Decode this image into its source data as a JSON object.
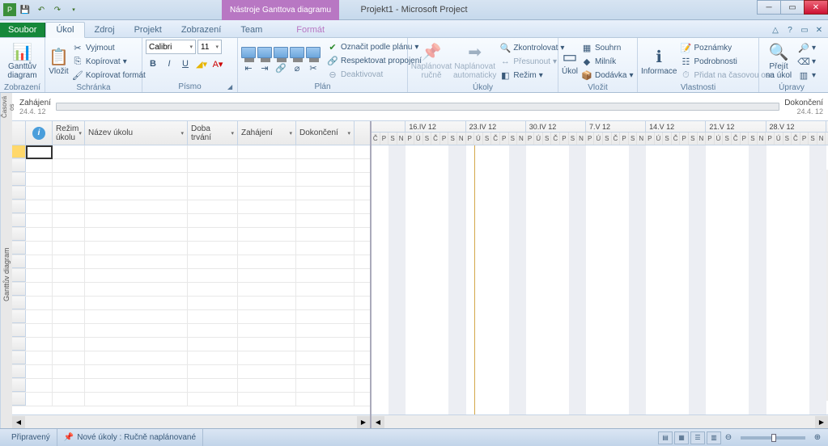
{
  "title": "Projekt1 - Microsoft Project",
  "contextual_tab_title": "Nástroje Ganttova diagramu",
  "tabs": {
    "file": "Soubor",
    "items": [
      "Úkol",
      "Zdroj",
      "Projekt",
      "Zobrazení",
      "Team"
    ],
    "format": "Formát",
    "active_index": 0
  },
  "ribbon": {
    "zobrazeni": {
      "label": "Zobrazení",
      "btn": "Ganttův\ndiagram"
    },
    "schranka": {
      "label": "Schránka",
      "paste": "Vložit",
      "cut": "Vyjmout",
      "copy": "Kopírovat",
      "format_painter": "Kopírovat formát"
    },
    "pismo": {
      "label": "Písmo",
      "font": "Calibri",
      "size": "11"
    },
    "plan": {
      "label": "Plán",
      "mark_on_track": "Označit podle plánu",
      "respect_links": "Respektovat propojení",
      "deactivate": "Deaktivovat"
    },
    "ukoly": {
      "label": "Úkoly",
      "manual": "Naplánovat\nručně",
      "auto": "Naplánovat\nautomaticky",
      "inspect": "Zkontrolovat",
      "move": "Přesunout",
      "mode": "Režim"
    },
    "vlozit": {
      "label": "Vložit",
      "task": "Úkol",
      "summary": "Souhrn",
      "milestone": "Milník",
      "deliverable": "Dodávka"
    },
    "vlastnosti": {
      "label": "Vlastnosti",
      "info": "Informace",
      "notes": "Poznámky",
      "details": "Podrobnosti",
      "add_timeline": "Přidat na časovou osu"
    },
    "upravy": {
      "label": "Úpravy",
      "scroll": "Přejít\nna úkol"
    }
  },
  "timeline": {
    "start_label": "Zahájení",
    "end_label": "Dokončení",
    "start_date": "24.4. 12",
    "end_date": "24.4. 12",
    "side_label": "Časová os"
  },
  "grid": {
    "columns": {
      "mode": "Režim úkolu",
      "name": "Název úkolu",
      "duration": "Doba trvání",
      "start": "Zahájení",
      "finish": "Dokončení"
    }
  },
  "gantt": {
    "side_label": "Ganttův diagram",
    "weeks": [
      "16.IV 12",
      "23.IV 12",
      "30.IV 12",
      "7.V 12",
      "14.V 12",
      "21.V 12",
      "28.V 12"
    ],
    "first_days": [
      "Č",
      "P",
      "S",
      "N"
    ],
    "days": [
      "P",
      "Ú",
      "S",
      "Č",
      "P",
      "S",
      "N"
    ]
  },
  "statusbar": {
    "ready": "Připravený",
    "new_tasks": "Nové úkoly : Ručně naplánované"
  }
}
